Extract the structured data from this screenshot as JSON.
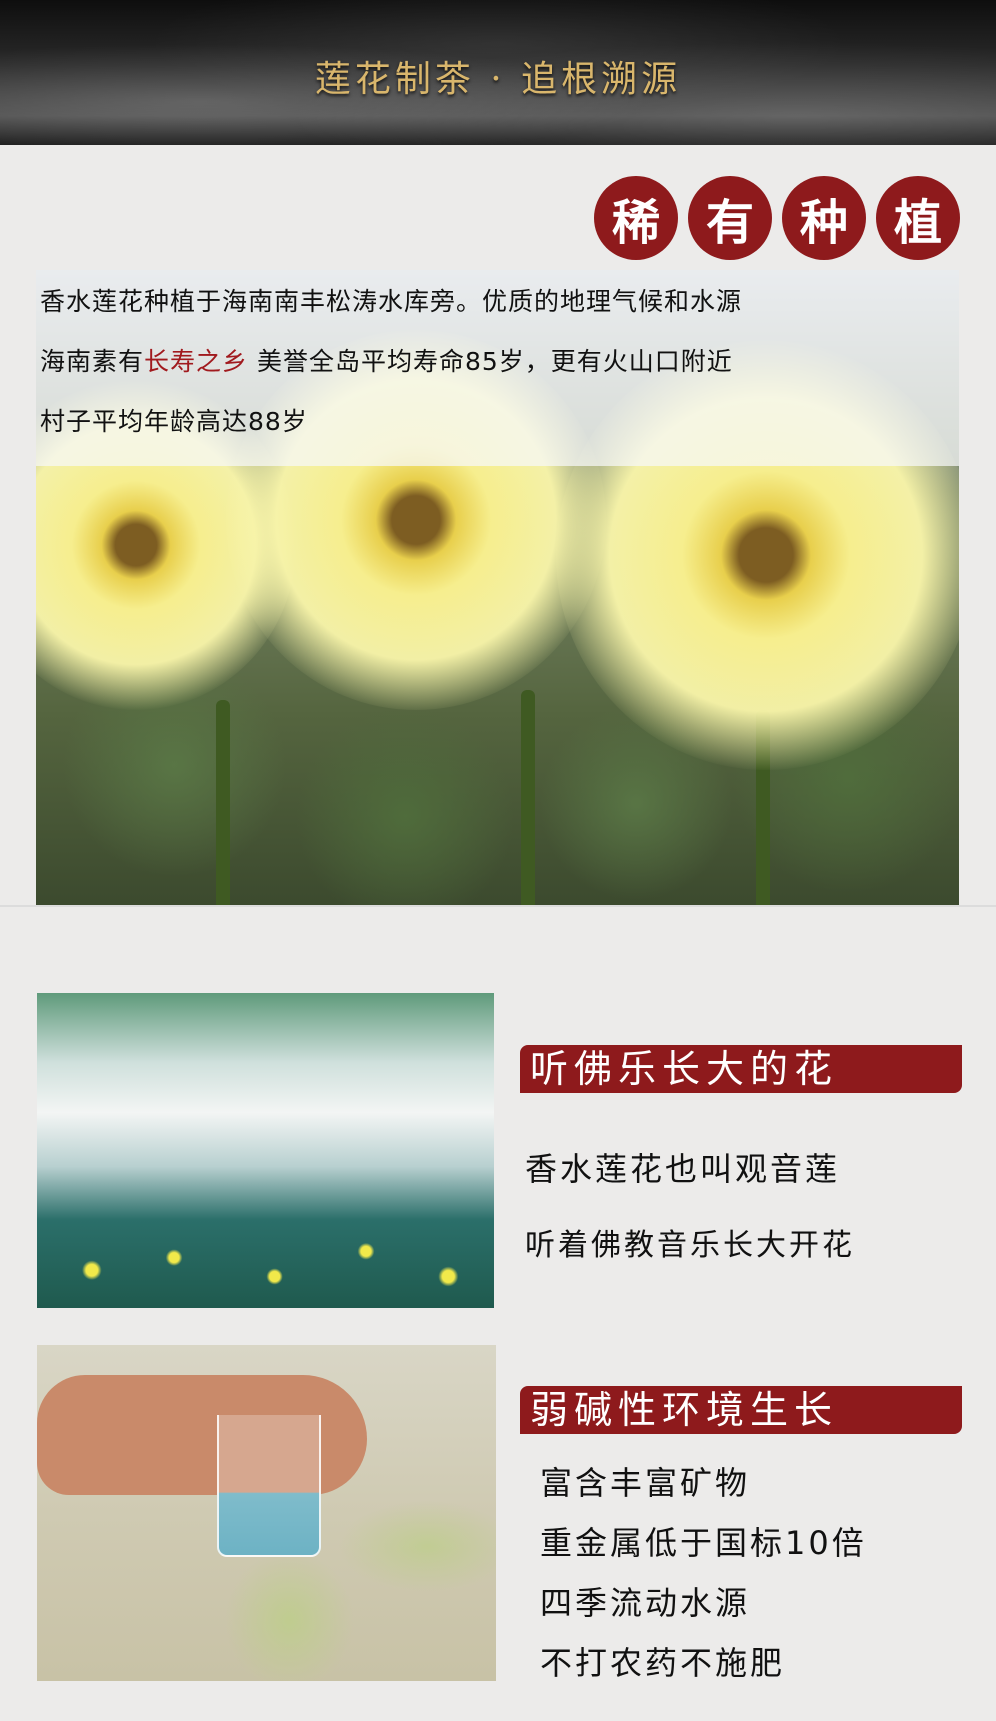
{
  "banner": {
    "title": "莲花制茶 · 追根溯源"
  },
  "badge": {
    "chars": [
      "稀",
      "有",
      "种",
      "植"
    ]
  },
  "intro": {
    "line1": "香水莲花种植于海南南丰松涛水库旁。优质的地理气候和水源",
    "line2_pre": "海南素有",
    "line2_highlight": "长寿之乡",
    "line2_post": " 美誉全岛平均寿命85岁，更有火山口附近",
    "line3": "村子平均年龄高达88岁"
  },
  "colors": {
    "accent_red": "#8e1a1c",
    "highlight_red": "#a11a1e",
    "title_gold": "#d9b66c"
  },
  "section1": {
    "title": "听佛乐长大的花",
    "lines": [
      "香水莲花也叫观音莲",
      "听着佛教音乐长大开花"
    ]
  },
  "section2": {
    "title": "弱碱性环境生长",
    "lines": [
      "富含丰富矿物",
      "重金属低于国标10倍",
      "四季流动水源",
      "不打农药不施肥"
    ]
  }
}
